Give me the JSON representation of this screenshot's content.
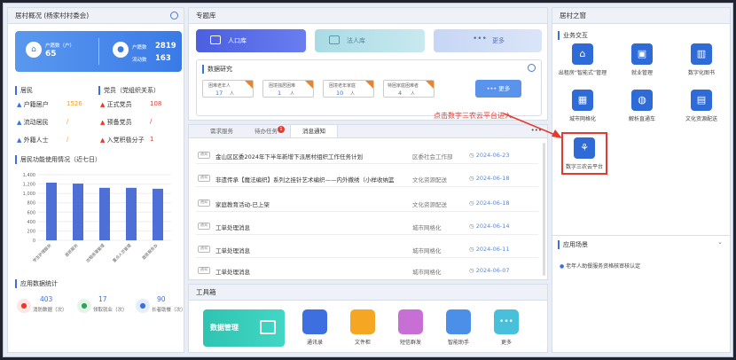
{
  "left": {
    "title": "居村概况 (杨家村村委会)",
    "card": {
      "label1": "户籍数（户）",
      "value1": "65",
      "label2": "户籍数",
      "value2": "2819",
      "label3": "流动数",
      "value3": "163"
    },
    "residents_title": "居民",
    "party_title": "党员（党组织关系）",
    "residents": [
      {
        "label": "户籍居户",
        "value": "1526"
      },
      {
        "label": "流动居民",
        "value": "/"
      },
      {
        "label": "外籍人士",
        "value": "/"
      }
    ],
    "party": [
      {
        "label": "正式党员",
        "value": "108"
      },
      {
        "label": "预备党员",
        "value": "/"
      },
      {
        "label": "入党积极分子",
        "value": "1"
      }
    ],
    "usage_title": "居民功能使用情况（近七日）",
    "app_title": "应用数据统计",
    "stats": [
      {
        "value": "403",
        "label": "消防数据（次）"
      },
      {
        "value": "17",
        "label": "领取就业（次）"
      },
      {
        "value": "90",
        "label": "长者助餐（次）"
      }
    ]
  },
  "chart_data": {
    "type": "bar",
    "categories": [
      "学生护理服务",
      "居民服务",
      "出租房屋管理",
      "重点人员管理",
      "居民服务办"
    ],
    "values": [
      1230,
      1210,
      1120,
      1120,
      1100
    ],
    "ylim": [
      0,
      1400
    ],
    "yticks": [
      "1,400",
      "1,200",
      "1,000",
      "800",
      "600",
      "400",
      "200",
      "0"
    ]
  },
  "topic": {
    "title": "专题库",
    "buttons": [
      "人口库",
      "法人库",
      "更多"
    ],
    "stats_title": "数据研究",
    "stats": [
      {
        "label": "困难老年人",
        "value": "17",
        "unit": "人"
      },
      {
        "label": "困境独居困难",
        "value": "1",
        "unit": "人"
      },
      {
        "label": "困境老年家庭",
        "value": "10",
        "unit": "人"
      },
      {
        "label": "特困家庭困难者",
        "value": "4",
        "unit": "人"
      }
    ],
    "more": "更多"
  },
  "news": {
    "tabs": [
      "需求服务",
      "待办任务",
      "消息通知"
    ],
    "rows": [
      {
        "tag": "通知",
        "title": "金山区区委2024年下半年新增下派居村组织工作任务计划",
        "src": "区委社会工作部",
        "date": "2024-06-23"
      },
      {
        "tag": "通知",
        "title": "非遗传承【魔法编织】系列之挂针艺术编织——内外撒绣（小样收纳篮",
        "src": "文化资源配送",
        "date": "2024-06-18"
      },
      {
        "tag": "通知",
        "title": "家庭教育活动-已上架",
        "src": "文化资源配送",
        "date": "2024-06-18"
      },
      {
        "tag": "通知",
        "title": "工单处理消息",
        "src": "城市网格化",
        "date": "2024-06-14"
      },
      {
        "tag": "通知",
        "title": "工单处理消息",
        "src": "城市网格化",
        "date": "2024-06-11"
      },
      {
        "tag": "通知",
        "title": "工单处理消息",
        "src": "城市网格化",
        "date": "2024-06-07"
      }
    ],
    "annotation": "点击数字三农云平台进入",
    "badge": "1"
  },
  "tools": {
    "title": "工具箱",
    "banner": "数据管理",
    "items": [
      "通讯录",
      "文件柜",
      "短信群发",
      "智能助手",
      "更多"
    ]
  },
  "right": {
    "title": "居村之窗",
    "section": "业务交互",
    "items": [
      "出租房“智能式”管理",
      "就业管理",
      "数字化图书",
      "城市网格化",
      "解析直通车",
      "文化资源配送",
      "数字三农云平台"
    ],
    "scene_title": "应用场景",
    "scene_item": "老年人助餐服务资格核审核认定"
  },
  "colors": {
    "primary": "#3e6fe0",
    "accent_red": "#e53a2f",
    "amber": "#f0a020"
  }
}
